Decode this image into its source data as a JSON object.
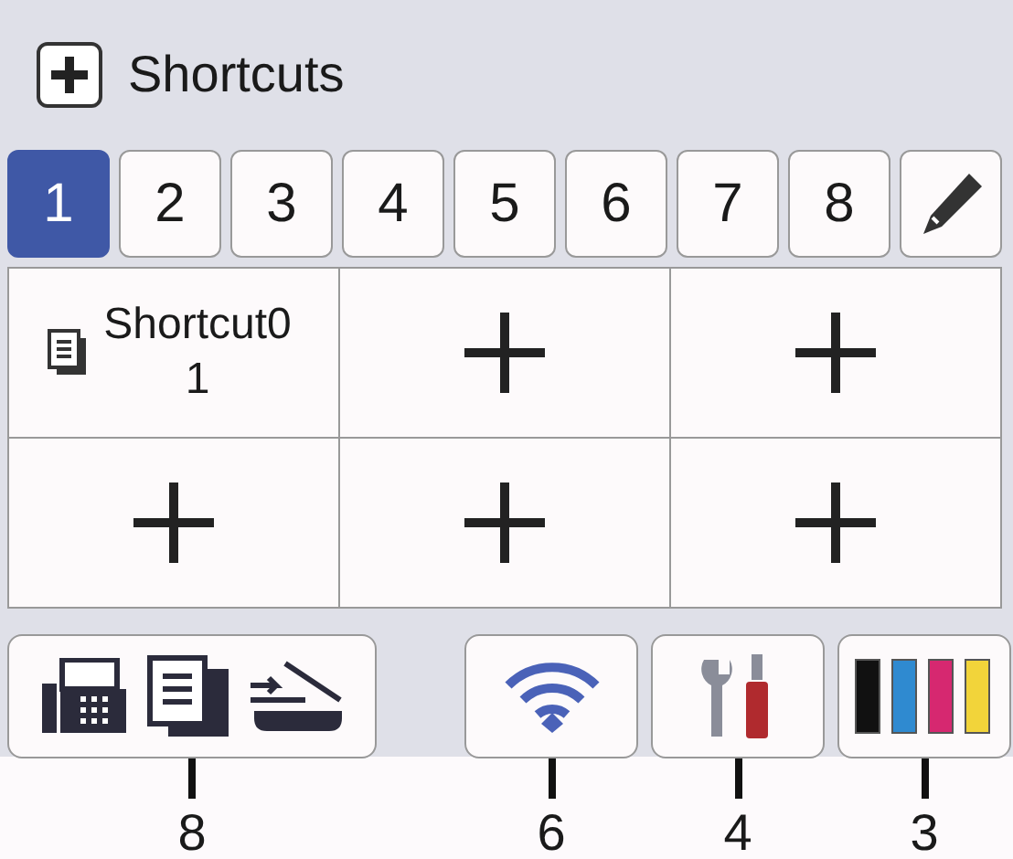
{
  "header": {
    "title": "Shortcuts"
  },
  "tabs": [
    {
      "kind": "number",
      "label": "1",
      "selected": true
    },
    {
      "kind": "number",
      "label": "2",
      "selected": false
    },
    {
      "kind": "number",
      "label": "3",
      "selected": false
    },
    {
      "kind": "number",
      "label": "4",
      "selected": false
    },
    {
      "kind": "number",
      "label": "5",
      "selected": false
    },
    {
      "kind": "number",
      "label": "6",
      "selected": false
    },
    {
      "kind": "number",
      "label": "7",
      "selected": false
    },
    {
      "kind": "number",
      "label": "8",
      "selected": false
    },
    {
      "kind": "edit",
      "selected": false
    }
  ],
  "grid": [
    {
      "kind": "shortcut",
      "label": "Shortcut01"
    },
    {
      "kind": "empty"
    },
    {
      "kind": "empty"
    },
    {
      "kind": "empty"
    },
    {
      "kind": "empty"
    },
    {
      "kind": "empty"
    }
  ],
  "status_buttons": [
    {
      "kind": "modes",
      "callout": "8"
    },
    {
      "kind": "wifi",
      "callout": "6"
    },
    {
      "kind": "tools",
      "callout": "4"
    },
    {
      "kind": "ink",
      "callout": "3"
    }
  ]
}
